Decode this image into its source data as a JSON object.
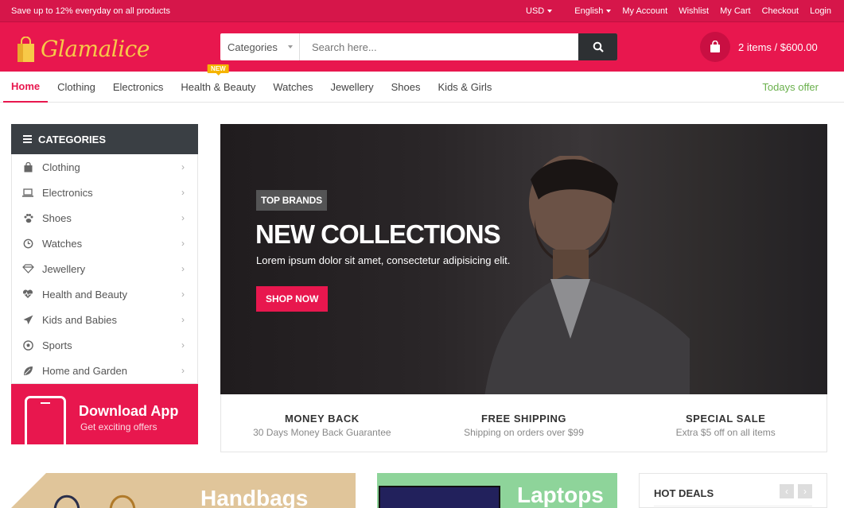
{
  "topbar": {
    "promo": "Save up to 12% everyday on all products",
    "currency": "USD",
    "language": "English",
    "links": [
      "My Account",
      "Wishlist",
      "My Cart",
      "Checkout",
      "Login"
    ]
  },
  "header": {
    "logo_text": "Glamalice",
    "search": {
      "category_label": "Categories",
      "placeholder": "Search here..."
    },
    "cart_summary": "2 items / $600.00"
  },
  "nav": {
    "items": [
      "Home",
      "Clothing",
      "Electronics",
      "Health & Beauty",
      "Watches",
      "Jewellery",
      "Shoes",
      "Kids & Girls"
    ],
    "new_badge": "NEW",
    "offer": "Todays offer"
  },
  "sidebar": {
    "title": "CATEGORIES",
    "items": [
      {
        "label": "Clothing",
        "icon": "shopping-bag-icon"
      },
      {
        "label": "Electronics",
        "icon": "laptop-icon"
      },
      {
        "label": "Shoes",
        "icon": "paw-icon"
      },
      {
        "label": "Watches",
        "icon": "clock-icon"
      },
      {
        "label": "Jewellery",
        "icon": "diamond-icon"
      },
      {
        "label": "Health and Beauty",
        "icon": "heartbeat-icon"
      },
      {
        "label": "Kids and Babies",
        "icon": "paper-plane-icon"
      },
      {
        "label": "Sports",
        "icon": "soccer-ball-icon"
      },
      {
        "label": "Home and Garden",
        "icon": "leaf-icon"
      }
    ],
    "app": {
      "title": "Download App",
      "subtitle": "Get exciting offers"
    }
  },
  "hero": {
    "tag": "TOP BRANDS",
    "title": "NEW COLLECTIONS",
    "subtitle": "Lorem ipsum dolor sit amet, consectetur adipisicing elit.",
    "cta": "SHOP NOW"
  },
  "features": [
    {
      "title": "MONEY BACK",
      "text": "30 Days Money Back Guarantee"
    },
    {
      "title": "FREE SHIPPING",
      "text": "Shipping on orders over $99"
    },
    {
      "title": "SPECIAL SALE",
      "text": "Extra $5 off on all items"
    }
  ],
  "banners": {
    "handbags": "Handbags",
    "laptops": "Laptops",
    "hot_deals": "HOT DEALS"
  },
  "colors": {
    "brand": "#e8174e",
    "dark": "#3a3f44",
    "offer": "#6ab04c",
    "badge": "#f5b400"
  }
}
